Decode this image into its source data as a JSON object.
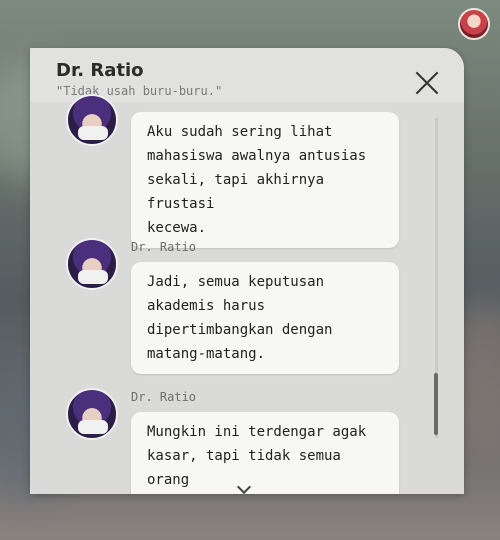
{
  "header": {
    "title": "Dr. Ratio",
    "subtitle": "\"Tidak usah buru-buru.\""
  },
  "messages": [
    {
      "sender": "",
      "text": "Aku sudah sering lihat\nmahasiswa awalnya antusias\nsekali, tapi akhirnya frustasi\nkecewa."
    },
    {
      "sender": "Dr. Ratio",
      "text": "Jadi, semua keputusan\nakademis harus\ndipertimbangkan dengan\nmatang-matang."
    },
    {
      "sender": "Dr. Ratio",
      "text": "Mungkin ini terdengar agak\nkasar, tapi tidak semua orang\ncocok jadi sarjana."
    }
  ],
  "icons": {
    "close": "close-icon",
    "scroll_down": "chevron-down-icon",
    "profile": "avatar"
  },
  "colors": {
    "panel": "#dadad8",
    "bubble": "#f7f7f6",
    "text": "#222222"
  }
}
